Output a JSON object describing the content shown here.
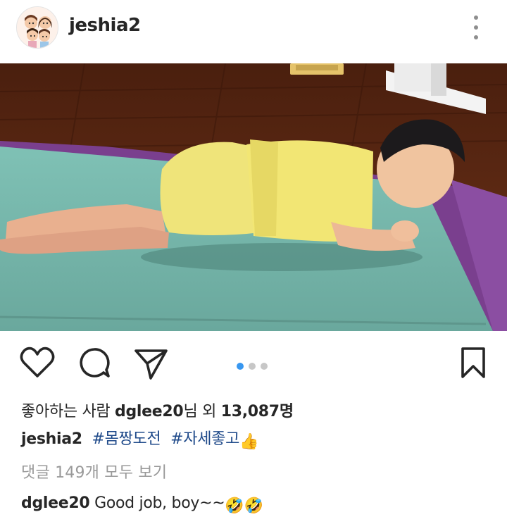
{
  "post": {
    "username": "jeshia2",
    "avatar_icon": "family-cartoon-avatar-icon",
    "more_icon": "more-vertical-icon"
  },
  "actions": {
    "like_icon": "heart-icon",
    "comment_icon": "comment-icon",
    "share_icon": "paper-plane-icon",
    "save_icon": "bookmark-icon",
    "carousel_total": 3,
    "carousel_active": 1,
    "accent_color": "#3897f0"
  },
  "likes": {
    "prefix": "좋아하는 사람 ",
    "user": "dglee20",
    "middle": "님 외 ",
    "count": "13,087",
    "suffix": "명"
  },
  "caption": {
    "user": "jeshia2",
    "tags": [
      "#몸짱도전",
      "#자세좋고"
    ],
    "emoji": "👍",
    "tag_color": "#1f4a8a"
  },
  "comments": {
    "view_all": "댓글 149개 모두 보기",
    "first": {
      "user": "dglee20",
      "text": "Good job, boy~~",
      "emoji": "🤣🤣"
    }
  }
}
